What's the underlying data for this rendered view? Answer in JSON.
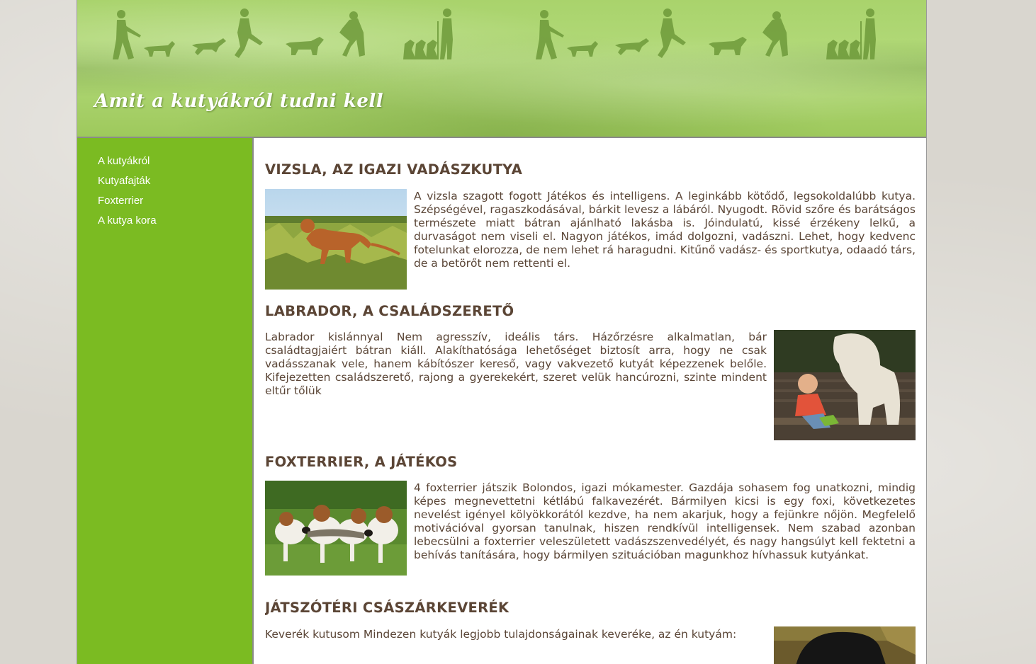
{
  "site": {
    "title": "Amit a kutyákról tudni kell"
  },
  "nav": {
    "items": [
      {
        "label": "A kutyákról"
      },
      {
        "label": "Kutyafajták"
      },
      {
        "label": "Foxterrier"
      },
      {
        "label": "A kutya kora"
      }
    ]
  },
  "articles": [
    {
      "heading": "VIZSLA, AZ IGAZI VADÁSZKUTYA",
      "image": "vizsla-photo",
      "text": "A vizsla szagott fogott Játékos és intelligens. A leginkább kötődő, legsokoldalúbb kutya. Szépségével, ragaszkodásával, bárkit levesz a lábáról. Nyugodt. Rövid szőre és barátságos természete miatt bátran ajánlható lakásba is. Jóindulatú, kissé érzékeny lelkű, a durvaságot nem viseli el. Nagyon játékos, imád dolgozni, vadászni. Lehet, hogy kedvenc fotelunkat elorozza, de nem lehet rá haragudni. Kitűnő vadász- és sportkutya, odaadó társ, de a betörőt nem rettenti el."
    },
    {
      "heading": "LABRADOR, A CSALÁDSZERETŐ",
      "image": "labrador-photo",
      "text": "Labrador kislánnyal Nem agresszív, ideális társ. Házőrzésre alkalmatlan, bár családtagjaiért bátran kiáll. Alakíthatósága lehetőséget biztosít arra, hogy ne csak vadásszanak vele, hanem kábítószer kereső, vagy vakvezető kutyát képezzenek belőle. Kifejezetten családszerető, rajong a gyerekekért, szeret velük hancúrozni, szinte mindent eltűr tőlük"
    },
    {
      "heading": "FOXTERRIER, A JÁTÉKOS",
      "image": "foxterrier-photo",
      "text": "4 foxterrier játszik Bolondos, igazi mókamester. Gazdája sohasem fog unatkozni, mindig képes megnevettetni kétlábú falkavezérét. Bármilyen kicsi is egy foxi, következetes nevelést igényel kölyökkorától kezdve, ha nem akarjuk, hogy a fejünkre nőjön. Megfelelő motivációval gyorsan tanulnak, hiszen rendkívül intelligensek. Nem szabad azonban lebecsülni a foxterrier veleszületett vadászszenvedélyét, és nagy hangsúlyt kell fektetni a behívás tanítására, hogy bármilyen szituációban magunkhoz hívhassuk kutyánkat."
    },
    {
      "heading": "JÁTSZÓTÉRI CSÁSZÁRKEVERÉK",
      "image": "mixed-breed-photo",
      "text": "Keverék kutusom Mindezen kutyák legjobb tulajdonságainak keveréke, az én kutyám:"
    }
  ],
  "colors": {
    "header_green": "#a9d36c",
    "sidebar_green": "#7bbb22",
    "heading_brown": "#5b4535",
    "text_brown": "#5a4536"
  }
}
